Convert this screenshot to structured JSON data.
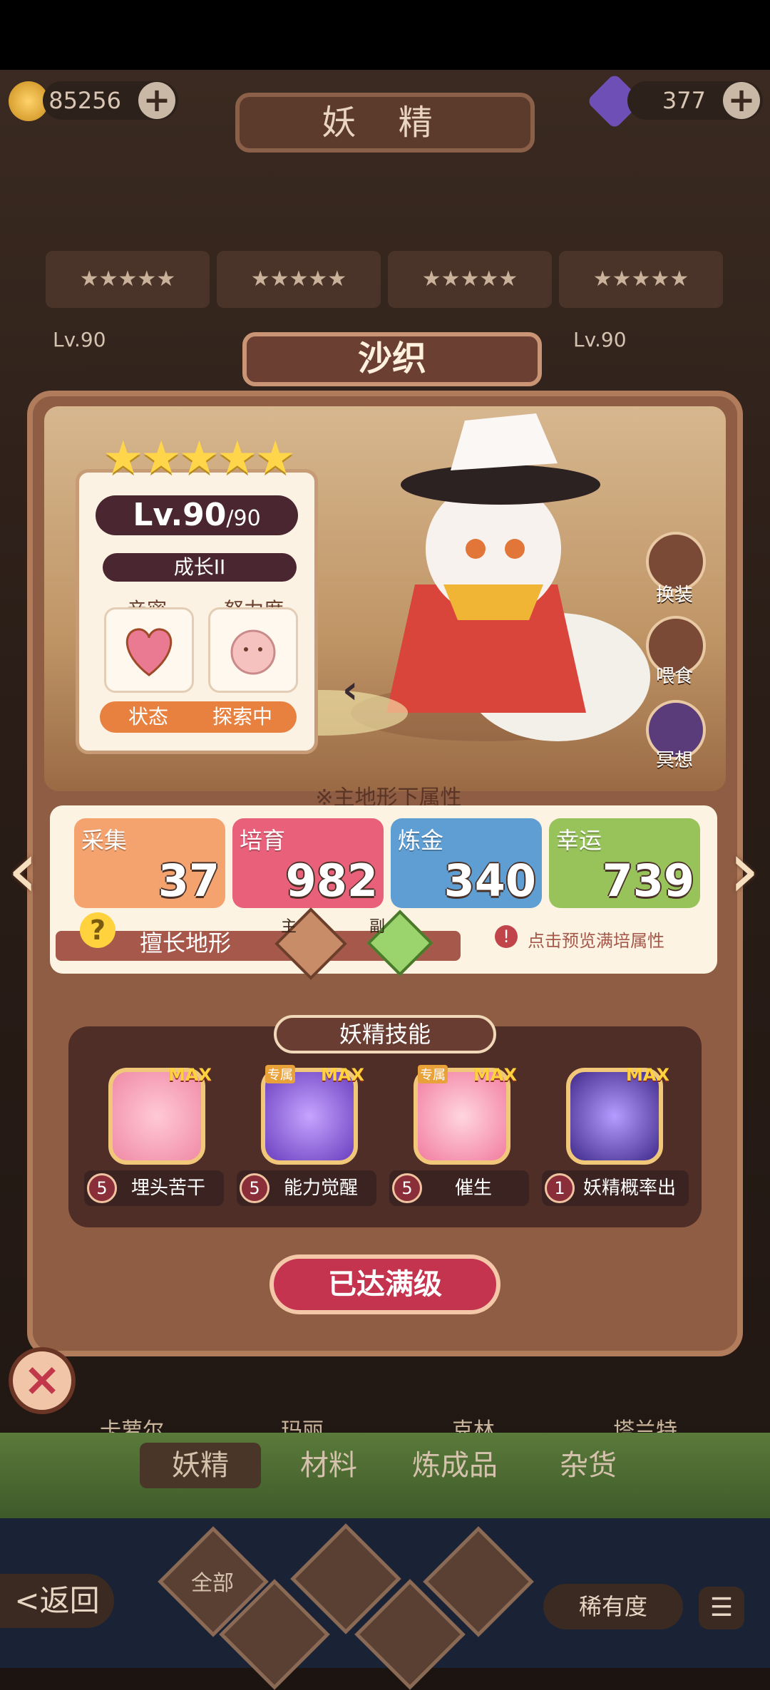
{
  "topbar": {
    "gold": "85256",
    "gems": "377",
    "title": "妖 精"
  },
  "bg_levels": {
    "left": "Lv.90",
    "right": "Lv.90"
  },
  "fairy": {
    "name": "沙织",
    "stars": "★★★★★",
    "level": "Lv.90",
    "level_max": "/90",
    "growth": "成长II",
    "intimacy_label": "亲密",
    "effort_label": "努力度",
    "status_label": "状态",
    "status_value": "探索中"
  },
  "side_buttons": {
    "dress": "换装",
    "feed": "喂食",
    "meditate": "冥想"
  },
  "attributes": {
    "header": "※主地形下属性",
    "gather": {
      "label": "采集",
      "value": "37"
    },
    "nurture": {
      "label": "培育",
      "value": "982"
    },
    "alchemy": {
      "label": "炼金",
      "value": "340"
    },
    "luck": {
      "label": "幸运",
      "value": "739"
    },
    "terrain_label": "擅长地形",
    "main_tag": "主",
    "sub_tag": "副",
    "preview_hint": "点击预览满培属性"
  },
  "skills": {
    "title": "妖精技能",
    "max_tag": "MAX",
    "exclusive_tag": "专属",
    "items": [
      {
        "level": "5",
        "name": "埋头苦干"
      },
      {
        "level": "5",
        "name": "能力觉醒"
      },
      {
        "level": "5",
        "name": "催生"
      },
      {
        "level": "1",
        "name": "妖精概率出"
      }
    ]
  },
  "max_level_button": "已达满级",
  "bg_names": [
    "卡萝尔",
    "玛丽",
    "克林",
    "塔兰特"
  ],
  "bottom_tabs": [
    "妖精",
    "材料",
    "炼成品",
    "杂货"
  ],
  "filters": {
    "all": "全部"
  },
  "back_button": "<返回",
  "rarity_button": "稀有度",
  "colors": {
    "gather": "#f4a36f",
    "nurture": "#e8607a",
    "alchemy": "#5f9ed3",
    "luck": "#97c35a",
    "maxbtn": "#c4344f"
  }
}
